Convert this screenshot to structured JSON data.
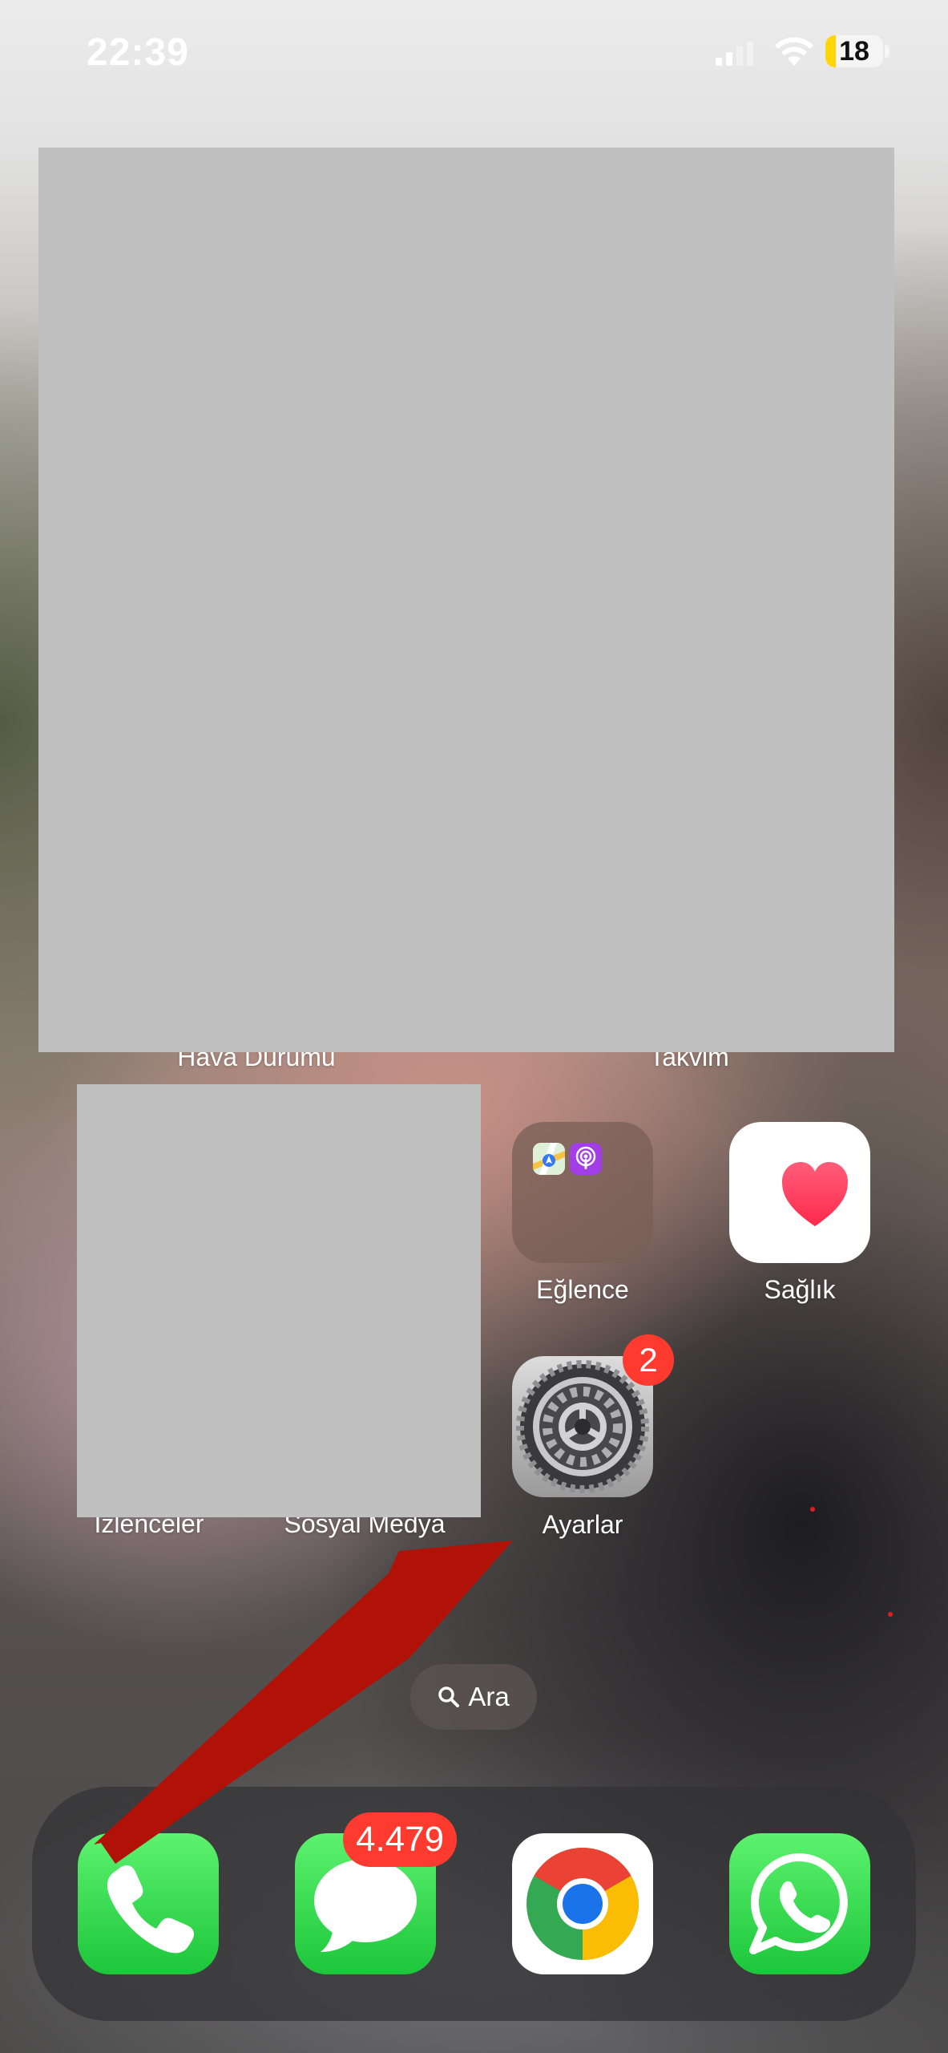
{
  "status_bar": {
    "time": "22:39",
    "battery_level": "18",
    "battery_fraction": 0.18,
    "battery_color": "#ffd60a",
    "icons": [
      "cellular-signal-icon",
      "wifi-icon",
      "battery-icon"
    ]
  },
  "widgets": {
    "weather_label": "Hava Durumu",
    "calendar_label": "Takvim"
  },
  "apps": {
    "entertainment": {
      "label": "Eğlence",
      "icon": "folder-icon",
      "contents": [
        "maps-icon",
        "podcasts-icon"
      ]
    },
    "health": {
      "label": "Sağlık",
      "icon": "heart-icon"
    },
    "watchlist": {
      "label": "İzlenceler"
    },
    "social_media": {
      "label": "Sosyal Medya"
    },
    "settings": {
      "label": "Ayarlar",
      "badge": "2",
      "icon": "gear-icon"
    }
  },
  "search": {
    "label": "Ara",
    "icon": "magnifier-icon"
  },
  "dock": {
    "phone": {
      "icon": "phone-icon"
    },
    "messages": {
      "icon": "messages-icon",
      "badge": "4.479"
    },
    "chrome": {
      "icon": "chrome-icon"
    },
    "whatsapp": {
      "icon": "whatsapp-icon"
    }
  },
  "annotation": {
    "icon": "red-arrow-icon",
    "color": "#b01208"
  },
  "colors": {
    "badge": "#ff3b30",
    "ios_green": "#34c759",
    "heart": "#ff2d55"
  }
}
